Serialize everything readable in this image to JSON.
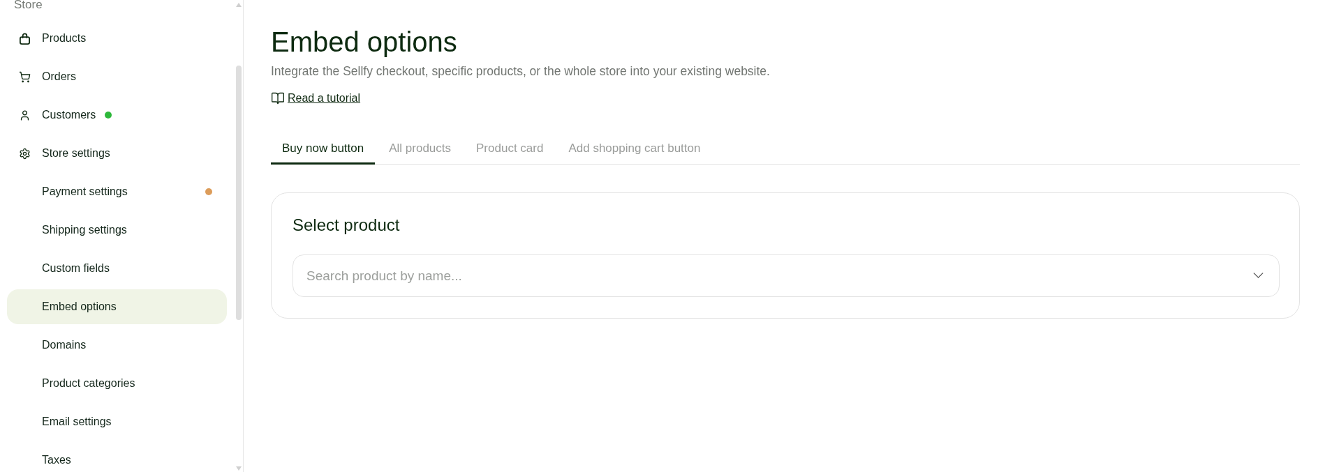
{
  "sidebar": {
    "section_label": "Store",
    "items": [
      {
        "label": "Products",
        "selected": false
      },
      {
        "label": "Orders",
        "selected": false
      },
      {
        "label": "Customers",
        "selected": false,
        "color": "#2db83a"
      },
      {
        "label": "Store settings",
        "selected": false,
        "children": [
          {
            "label": "Payment settings",
            "selected": false,
            "color": "#dc9c5a"
          },
          {
            "label": "Shipping settings",
            "selected": false
          },
          {
            "label": "Custom fields",
            "selected": false
          },
          {
            "label": "Embed options",
            "selected": true
          },
          {
            "label": "Domains",
            "selected": false
          },
          {
            "label": "Product categories",
            "selected": false
          },
          {
            "label": "Email settings",
            "selected": false
          },
          {
            "label": "Taxes",
            "selected": false
          }
        ]
      }
    ]
  },
  "page": {
    "title": "Embed options",
    "subtitle": "Integrate the Sellfy checkout, specific products, or the whole store into your existing website.",
    "tutorial_link": "Read a tutorial"
  },
  "tabs": [
    {
      "label": "Buy now button",
      "selected": true
    },
    {
      "label": "All products",
      "selected": false
    },
    {
      "label": "Product card",
      "selected": false
    },
    {
      "label": "Add shopping cart button",
      "selected": false
    }
  ],
  "card": {
    "title": "Select product",
    "search": {
      "placeholder": "Search product by name..."
    }
  }
}
